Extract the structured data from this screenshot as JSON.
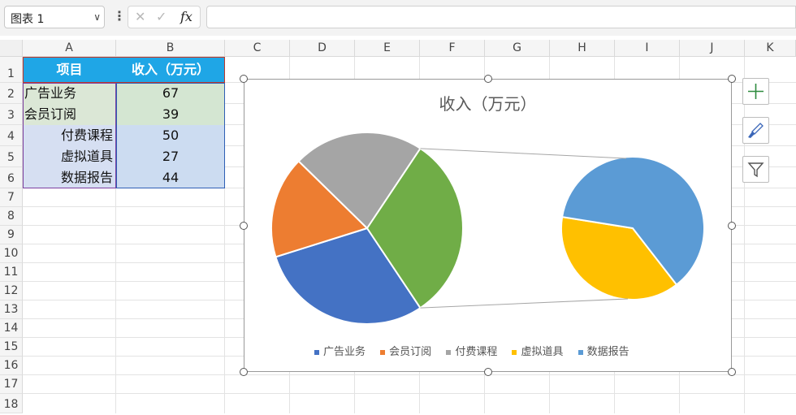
{
  "formula_bar": {
    "name_box": "图表 1",
    "fx_label": "fx",
    "formula_value": ""
  },
  "columns": [
    "A",
    "B",
    "C",
    "D",
    "E",
    "F",
    "G",
    "H",
    "I",
    "J",
    "K"
  ],
  "rows": [
    "1",
    "2",
    "3",
    "4",
    "5",
    "6",
    "7",
    "8",
    "9",
    "10",
    "11",
    "12",
    "13",
    "14",
    "15",
    "16",
    "17",
    "18"
  ],
  "table": {
    "header": [
      "项目",
      "收入（万元）"
    ],
    "rows": [
      {
        "item": "广告业务",
        "value": "67"
      },
      {
        "item": "会员订阅",
        "value": "39"
      },
      {
        "item": "付费课程",
        "value": "50"
      },
      {
        "item": "虚拟道具",
        "value": "27"
      },
      {
        "item": "数据报告",
        "value": "44"
      }
    ]
  },
  "colors": {
    "ad": "#4472C4",
    "member": "#ED7D31",
    "course": "#A5A5A5",
    "virtual": "#FFC000",
    "report": "#5B9BD5",
    "split_green": "#70AD47",
    "header_fill": "#1FA6E6"
  },
  "chart_data": {
    "type": "pie",
    "subtype": "pie-of-pie",
    "title": "收入（万元）",
    "categories": [
      "广告业务",
      "会员订阅",
      "付费课程",
      "虚拟道具",
      "数据报告"
    ],
    "values": [
      67,
      39,
      50,
      27,
      44
    ],
    "secondary_categories": [
      "虚拟道具",
      "数据报告"
    ],
    "legend_position": "bottom"
  },
  "side_buttons": [
    "add-chart-element-icon",
    "chart-style-brush-icon",
    "chart-filter-icon"
  ]
}
